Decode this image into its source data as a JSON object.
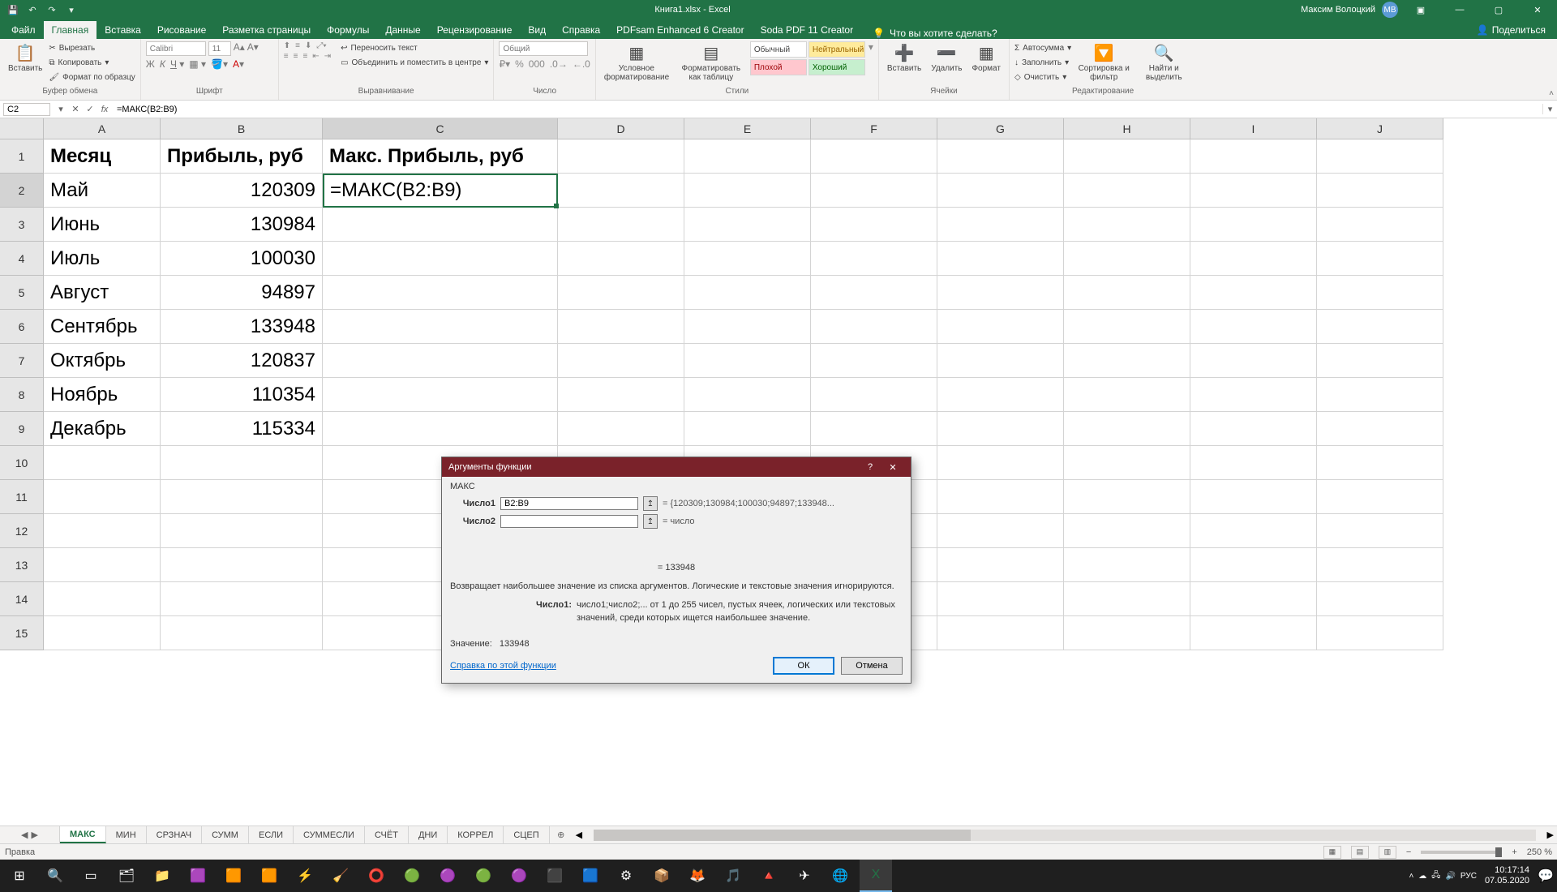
{
  "titlebar": {
    "doc_title": "Книга1.xlsx - Excel",
    "username": "Максим Волоцкий",
    "user_initials": "МВ"
  },
  "tabs": {
    "file": "Файл",
    "items": [
      "Главная",
      "Вставка",
      "Рисование",
      "Разметка страницы",
      "Формулы",
      "Данные",
      "Рецензирование",
      "Вид",
      "Справка",
      "PDFsam Enhanced 6 Creator",
      "Soda PDF 11 Creator"
    ],
    "active_index": 0,
    "tellme_placeholder": "Что вы хотите сделать?",
    "share": "Поделиться"
  },
  "ribbon": {
    "clipboard": {
      "paste": "Вставить",
      "cut": "Вырезать",
      "copy": "Копировать",
      "format_painter": "Формат по образцу",
      "label": "Буфер обмена"
    },
    "font": {
      "name": "Calibri",
      "size": "11",
      "label": "Шрифт"
    },
    "alignment": {
      "wrap": "Переносить текст",
      "merge": "Объединить и поместить в центре",
      "label": "Выравнивание"
    },
    "number": {
      "format": "Общий",
      "label": "Число"
    },
    "styles": {
      "cond": "Условное форматирование",
      "table": "Форматировать как таблицу",
      "normal": "Обычный",
      "neutral": "Нейтральный",
      "bad": "Плохой",
      "good": "Хороший",
      "label": "Стили"
    },
    "cells": {
      "insert": "Вставить",
      "delete": "Удалить",
      "format": "Формат",
      "label": "Ячейки"
    },
    "editing": {
      "autosum": "Автосумма",
      "fill": "Заполнить",
      "clear": "Очистить",
      "sort": "Сортировка и фильтр",
      "find": "Найти и выделить",
      "label": "Редактирование"
    }
  },
  "formula_bar": {
    "cell_ref": "C2",
    "formula": "=МАКС(B2:B9)"
  },
  "columns": [
    "A",
    "B",
    "C",
    "D",
    "E",
    "F",
    "G",
    "H",
    "I",
    "J"
  ],
  "table": {
    "headers": {
      "A": "Месяц",
      "B": "Прибыль, руб",
      "C": "Макс. Прибыль, руб"
    },
    "rows": [
      {
        "A": "Май",
        "B": "120309",
        "C": "=МАКС(B2:B9)"
      },
      {
        "A": "Июнь",
        "B": "130984"
      },
      {
        "A": "Июль",
        "B": "100030"
      },
      {
        "A": "Август",
        "B": "94897"
      },
      {
        "A": "Сентябрь",
        "B": "133948"
      },
      {
        "A": "Октябрь",
        "B": "120837"
      },
      {
        "A": "Ноябрь",
        "B": "110354"
      },
      {
        "A": "Декабрь",
        "B": "115334"
      }
    ]
  },
  "dialog": {
    "title": "Аргументы функции",
    "fn": "МАКС",
    "arg1_label": "Число1",
    "arg1_value": "B2:B9",
    "arg1_preview": "= {120309;130984;100030;94897;133948...",
    "arg2_label": "Число2",
    "arg2_preview": "= число",
    "result_eq": "= 133948",
    "description": "Возвращает наибольшее значение из списка аргументов. Логические и текстовые значения игнорируются.",
    "arg_name": "Число1:",
    "arg_help": "число1;число2;... от 1 до 255 чисел, пустых ячеек, логических или текстовых значений, среди которых ищется наибольшее значение.",
    "value_label": "Значение:",
    "value": "133948",
    "help_link": "Справка по этой функции",
    "ok": "ОК",
    "cancel": "Отмена"
  },
  "sheets": [
    "МАКС",
    "МИН",
    "СРЗНАЧ",
    "СУММ",
    "ЕСЛИ",
    "СУММЕСЛИ",
    "СЧЁТ",
    "ДНИ",
    "КОРРЕЛ",
    "СЦЕП"
  ],
  "sheets_active": 0,
  "statusbar": {
    "mode": "Правка",
    "zoom": "250 %"
  },
  "taskbar": {
    "lang": "РУС",
    "time": "10:17:14",
    "date": "07.05.2020"
  }
}
